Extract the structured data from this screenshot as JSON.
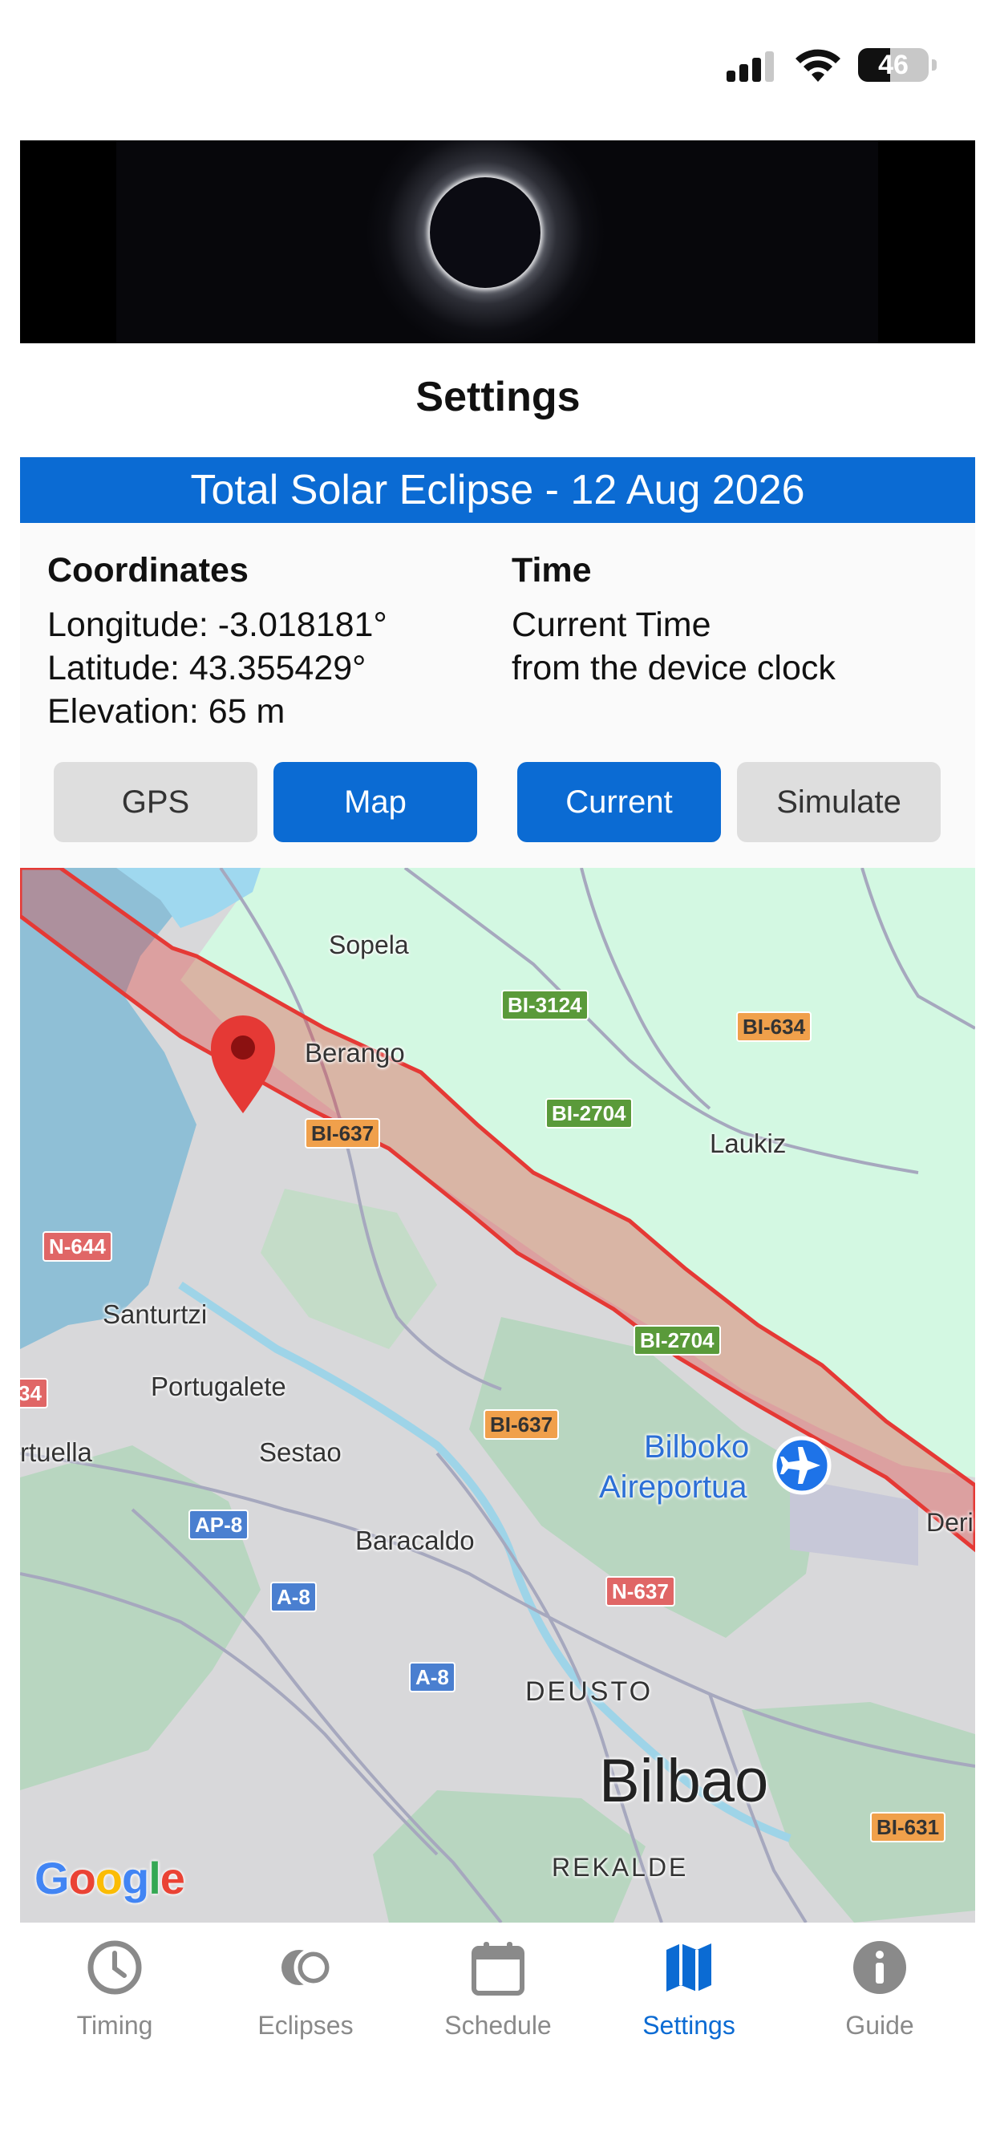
{
  "status_bar": {
    "battery": "46",
    "battery_level": 0.46
  },
  "page": {
    "title": "Settings"
  },
  "eclipse": {
    "header": "Total Solar Eclipse - 12 Aug 2026"
  },
  "coordinates": {
    "title": "Coordinates",
    "longitude": "Longitude: -3.018181°",
    "latitude": "Latitude: 43.355429°",
    "elevation": "Elevation: 65 m"
  },
  "time": {
    "title": "Time",
    "line1": "Current Time",
    "line2": "from the device clock"
  },
  "buttons": {
    "gps": "GPS",
    "map": "Map",
    "current": "Current",
    "simulate": "Simulate"
  },
  "map": {
    "places": {
      "sopela": "Sopela",
      "berango": "Berango",
      "laukiz": "Laukiz",
      "santurtzi": "Santurtzi",
      "portugalete": "Portugalete",
      "ortuella": "rtuella",
      "sestao": "Sestao",
      "baracaldo": "Baracaldo",
      "airport_line1": "Bilboko",
      "airport_line2": "Aireportua",
      "derio": "Deri",
      "deusto": "DEUSTO",
      "bilbao": "Bilbao",
      "rekalde": "REKALDE"
    },
    "roads": {
      "bi3124": "BI-3124",
      "bi634": "BI-634",
      "bi637_a": "BI-637",
      "bi2704_a": "BI-2704",
      "n644": "N-644",
      "edge_34": "34",
      "bi2704_b": "BI-2704",
      "bi637_b": "BI-637",
      "ap8": "AP-8",
      "a8_a": "A-8",
      "n637": "N-637",
      "a8_b": "A-8",
      "bi631": "BI-631"
    },
    "attribution": "Google",
    "colors": {
      "water": "#8fbfd6",
      "land": "#d8d8da",
      "green_area": "#d3f8e2",
      "forest": "#b8d6c0",
      "eclipse_path": "#e53935",
      "pin": "#e53935"
    }
  },
  "tabs": [
    {
      "label": "Timing",
      "icon": "clock-icon"
    },
    {
      "label": "Eclipses",
      "icon": "eclipses-icon"
    },
    {
      "label": "Schedule",
      "icon": "calendar-icon"
    },
    {
      "label": "Settings",
      "icon": "map-icon",
      "active": true
    },
    {
      "label": "Guide",
      "icon": "info-icon"
    }
  ],
  "accent_color": "#0b6bd3"
}
